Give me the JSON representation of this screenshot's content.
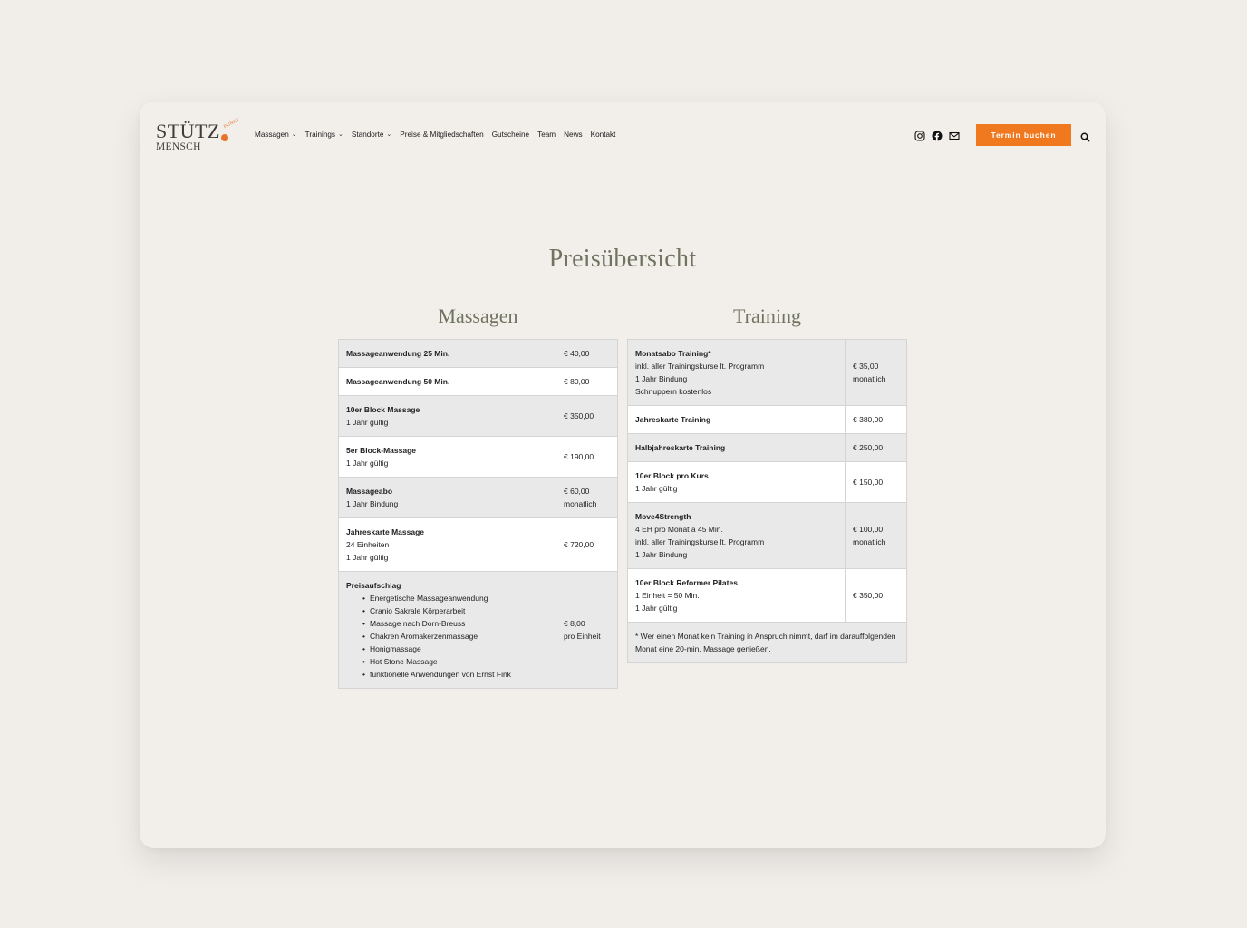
{
  "logo": {
    "line1": "STÜTZ",
    "line2": "MENSCH",
    "tagline": "PUNKT"
  },
  "nav": [
    {
      "label": "Massagen",
      "dropdown": true
    },
    {
      "label": "Trainings",
      "dropdown": true
    },
    {
      "label": "Standorte",
      "dropdown": true
    },
    {
      "label": "Preise & Mitgliedschaften",
      "dropdown": false
    },
    {
      "label": "Gutscheine",
      "dropdown": false
    },
    {
      "label": "Team",
      "dropdown": false
    },
    {
      "label": "News",
      "dropdown": false
    },
    {
      "label": "Kontakt",
      "dropdown": false
    }
  ],
  "header": {
    "book_button": "Termin buchen"
  },
  "icons": [
    "instagram-icon",
    "facebook-icon",
    "mail-icon",
    "search-icon"
  ],
  "colors": {
    "accent": "#f0781f",
    "heading": "#6f7360",
    "background": "#f1eeea"
  },
  "page": {
    "title": "Preisübersicht"
  },
  "massagen": {
    "title": "Massagen",
    "rows": [
      {
        "title": "Massageanwendung 25 Min.",
        "price": "€ 40,00",
        "shade": "grey"
      },
      {
        "title": "Massageanwendung 50 Min.",
        "price": "€ 80,00",
        "shade": "white"
      },
      {
        "title": "10er Block Massage",
        "lines": [
          "1 Jahr gültig"
        ],
        "price": "€ 350,00",
        "shade": "grey"
      },
      {
        "title": "5er Block-Massage",
        "lines": [
          "1 Jahr gültig"
        ],
        "price": "€ 190,00",
        "shade": "white"
      },
      {
        "title": "Massageabo",
        "lines": [
          "1 Jahr Bindung"
        ],
        "price": "€ 60,00",
        "price_note": "monatlich",
        "shade": "grey"
      },
      {
        "title": "Jahreskarte Massage",
        "lines": [
          "24 Einheiten",
          "1 Jahr gültig"
        ],
        "price": "€ 720,00",
        "shade": "white"
      },
      {
        "title": "Preisaufschlag",
        "bullets": [
          "Energetische Massageanwendung",
          "Cranio Sakrale Körperarbeit",
          "Massage nach Dorn-Breuss",
          "Chakren Aromakerzenmassage",
          "Honigmassage",
          "Hot Stone Massage",
          "funktionelle Anwendungen von Ernst Fink"
        ],
        "price": "€ 8,00",
        "price_note": "pro Einheit",
        "shade": "grey"
      }
    ]
  },
  "training": {
    "title": "Training",
    "rows": [
      {
        "title": "Monatsabo Training*",
        "lines": [
          "inkl. aller Trainingskurse lt. Programm",
          "1 Jahr Bindung",
          "Schnuppern kostenlos"
        ],
        "price": "€ 35,00",
        "price_note": "monatlich",
        "shade": "grey"
      },
      {
        "title": "Jahreskarte Training",
        "price": "€ 380,00",
        "shade": "white"
      },
      {
        "title": "Halbjahreskarte Training",
        "price": "€ 250,00",
        "shade": "grey"
      },
      {
        "title": "10er Block pro Kurs",
        "lines": [
          "1 Jahr gültig"
        ],
        "price": "€ 150,00",
        "shade": "white"
      },
      {
        "title": "Move4Strength",
        "lines": [
          "4 EH pro Monat á 45 Min.",
          "inkl. aller Trainingskurse lt. Programm",
          "1 Jahr Bindung"
        ],
        "price": "€ 100,00",
        "price_note": "monatlich",
        "shade": "grey"
      },
      {
        "title": "10er Block Reformer Pilates",
        "lines": [
          "1 Einheit = 50 Min.",
          "1 Jahr gültig"
        ],
        "price": "€ 350,00",
        "shade": "white"
      }
    ],
    "footnote": "* Wer einen Monat kein Training in Anspruch nimmt, darf im darauffolgenden Monat eine 20-min. Massage genießen."
  }
}
